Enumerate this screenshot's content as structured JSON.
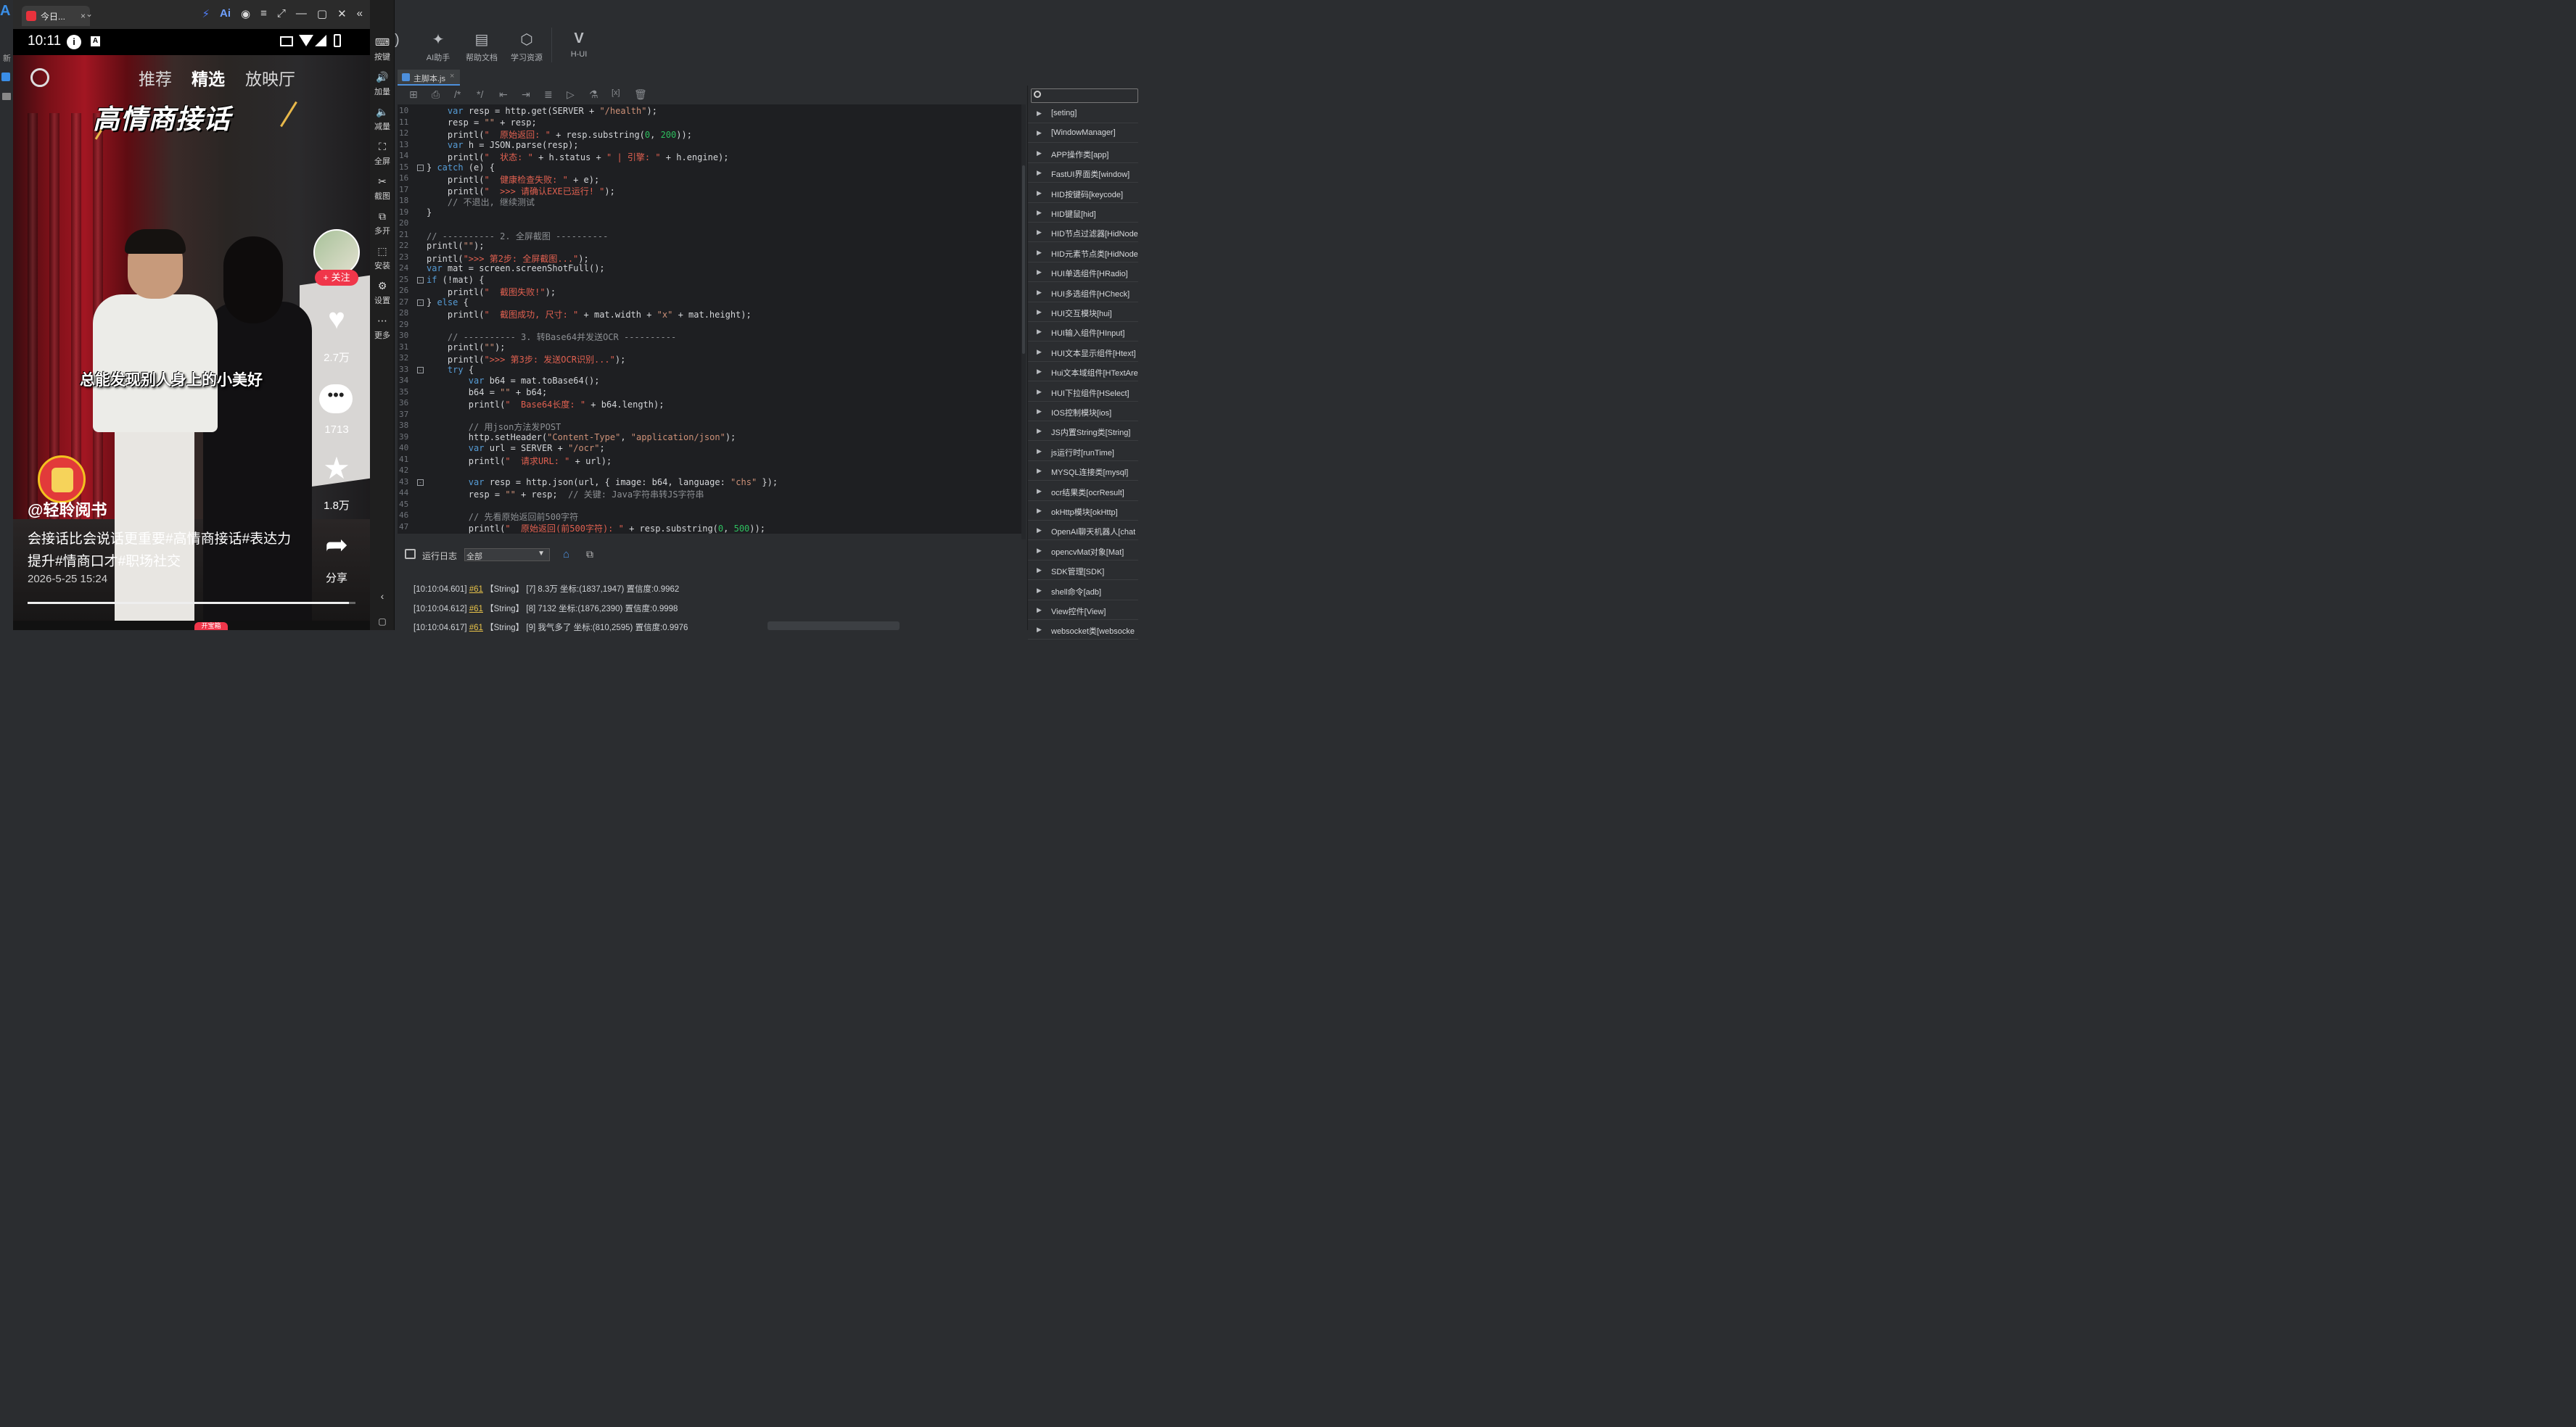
{
  "left_strip": {
    "label_a": "A",
    "label_new": "新"
  },
  "phone_window": {
    "tab_title": "今日...",
    "tab_close": "×",
    "controls": [
      "⚡",
      "Ai",
      "◉",
      "≡",
      "⤢",
      "—",
      "▢",
      "✕",
      "«"
    ]
  },
  "status_bar": {
    "time": "10:11",
    "info_icon": "i",
    "a_icon": "A"
  },
  "video": {
    "nav": {
      "recommend": "推荐",
      "featured": "精选",
      "theater": "放映厅"
    },
    "headline": "高情商接话",
    "subtitle": "总能发现别人身上的小美好",
    "follow_label": "+ 关注",
    "likes": "2.7万",
    "comments": "1713",
    "favorites": "1.8万",
    "share": "分享",
    "author": "@轻聆阅书",
    "description": "会接话比会说话更重要#高情商接话#表达力提升#情商口才#职场社交",
    "date": "2026-5-25 15:24",
    "progress": 0.98,
    "bottom_badge": "开宝箱"
  },
  "emulator_toolbar": [
    {
      "icon": "⌨",
      "label": "按键"
    },
    {
      "icon": "🔊",
      "label": "加量"
    },
    {
      "icon": "🔈",
      "label": "减量"
    },
    {
      "icon": "⛶",
      "label": "全屏"
    },
    {
      "icon": "✂",
      "label": "截图"
    },
    {
      "icon": "⧉",
      "label": "多开"
    },
    {
      "icon": "⬚",
      "label": "安装"
    },
    {
      "icon": "⚙",
      "label": "设置"
    },
    {
      "icon": "⋯",
      "label": "更多"
    }
  ],
  "ide_toolbar": [
    {
      "icon": "✦",
      "label": "AI助手"
    },
    {
      "icon": "▤",
      "label": "帮助文档"
    },
    {
      "icon": "⬡",
      "label": "学习资源"
    },
    {
      "icon": "V",
      "label": "H-UI"
    }
  ],
  "editor": {
    "file_tab": "主脚本.js",
    "lines": [
      {
        "n": "10",
        "code": "    var resp = http.get(SERVER + \"/health\");"
      },
      {
        "n": "11",
        "code": "    resp = \"\" + resp;"
      },
      {
        "n": "12",
        "code": "    printl(\"  原始返回: \" + resp.substring(0, 200));"
      },
      {
        "n": "13",
        "code": "    var h = JSON.parse(resp);"
      },
      {
        "n": "14",
        "code": "    printl(\"  状态: \" + h.status + \" | 引擎: \" + h.engine);"
      },
      {
        "n": "15",
        "code": "} catch (e) {"
      },
      {
        "n": "16",
        "code": "    printl(\"  健康检查失败: \" + e);"
      },
      {
        "n": "17",
        "code": "    printl(\"  >>> 请确认EXE已运行! \");"
      },
      {
        "n": "18",
        "code": "    // 不退出, 继续测试"
      },
      {
        "n": "19",
        "code": "}"
      },
      {
        "n": "20",
        "code": ""
      },
      {
        "n": "21",
        "code": "// ---------- 2. 全屏截图 ----------"
      },
      {
        "n": "22",
        "code": "printl(\"\");"
      },
      {
        "n": "23",
        "code": "printl(\">>> 第2步: 全屏截图...\");"
      },
      {
        "n": "24",
        "code": "var mat = screen.screenShotFull();"
      },
      {
        "n": "25",
        "code": "if (!mat) {"
      },
      {
        "n": "26",
        "code": "    printl(\"  截图失败!\");"
      },
      {
        "n": "27",
        "code": "} else {"
      },
      {
        "n": "28",
        "code": "    printl(\"  截图成功, 尺寸: \" + mat.width + \"x\" + mat.height);"
      },
      {
        "n": "29",
        "code": ""
      },
      {
        "n": "30",
        "code": "    // ---------- 3. 转Base64并发送OCR ----------"
      },
      {
        "n": "31",
        "code": "    printl(\"\");"
      },
      {
        "n": "32",
        "code": "    printl(\">>> 第3步: 发送OCR识别...\");"
      },
      {
        "n": "33",
        "code": "    try {"
      },
      {
        "n": "34",
        "code": "        var b64 = mat.toBase64();"
      },
      {
        "n": "35",
        "code": "        b64 = \"\" + b64;"
      },
      {
        "n": "36",
        "code": "        printl(\"  Base64长度: \" + b64.length);"
      },
      {
        "n": "37",
        "code": ""
      },
      {
        "n": "38",
        "code": "        // 用json方法发POST"
      },
      {
        "n": "39",
        "code": "        http.setHeader(\"Content-Type\", \"application/json\");"
      },
      {
        "n": "40",
        "code": "        var url = SERVER + \"/ocr\";"
      },
      {
        "n": "41",
        "code": "        printl(\"  请求URL: \" + url);"
      },
      {
        "n": "42",
        "code": ""
      },
      {
        "n": "43",
        "code": "        var resp = http.json(url, { image: b64, language: \"chs\" });"
      },
      {
        "n": "44",
        "code": "        resp = \"\" + resp;  // 关键: Java字符串转JS字符串"
      },
      {
        "n": "45",
        "code": ""
      },
      {
        "n": "46",
        "code": "        // 先看原始返回前500字符"
      },
      {
        "n": "47",
        "code": "        printl(\"  原始返回(前500字符): \" + resp.substring(0, 500));"
      }
    ]
  },
  "log_panel": {
    "title": "运行日志",
    "filter": "全部",
    "entries": [
      {
        "time": "[10:10:04.601]",
        "link": "#61",
        "type": "【String】",
        "msg": "[7] 8.3万 坐标:(1837,1947) 置信度:0.9962"
      },
      {
        "time": "[10:10:04.612]",
        "link": "#61",
        "type": "【String】",
        "msg": "[8] 7132 坐标:(1876,2390) 置信度:0.9998"
      },
      {
        "time": "[10:10:04.617]",
        "link": "#61",
        "type": "【String】",
        "msg": "[9] 我气多了 坐标:(810,2595) 置信度:0.9976"
      }
    ]
  },
  "api_panel": {
    "search_placeholder": "",
    "items": [
      "[seting]",
      "[WindowManager]",
      "APP操作类[app]",
      "FastUI界面类[window]",
      "HID按键码[keycode]",
      "HID键鼠[hid]",
      "HID节点过滤器[HidNode",
      "HID元素节点类[HidNode",
      "HUI单选组件[HRadio]",
      "HUI多选组件[HCheck]",
      "HUI交互模块[hui]",
      "HUI输入组件[HInput]",
      "HUI文本显示组件[Htext]",
      "Hui文本域组件[HTextAre",
      "HUI下拉组件[HSelect]",
      "IOS控制模块[ios]",
      "JS内置String类[String]",
      "js运行时[runTime]",
      "MYSQL连接类[mysql]",
      "ocr结果类[ocrResult]",
      "okHttp模块[okHttp]",
      "OpenAI聊天机器人[chat",
      "opencvMat对象[Mat]",
      "SDK管理[SDK]",
      "shell命令[adb]",
      "View控件[View]",
      "websocket类[websocke"
    ]
  },
  "colors": {
    "ide_bg": "#2b2d30",
    "editor_bg": "#1e1f22",
    "accent": "#4d8fdb",
    "red": "#e8323c"
  }
}
